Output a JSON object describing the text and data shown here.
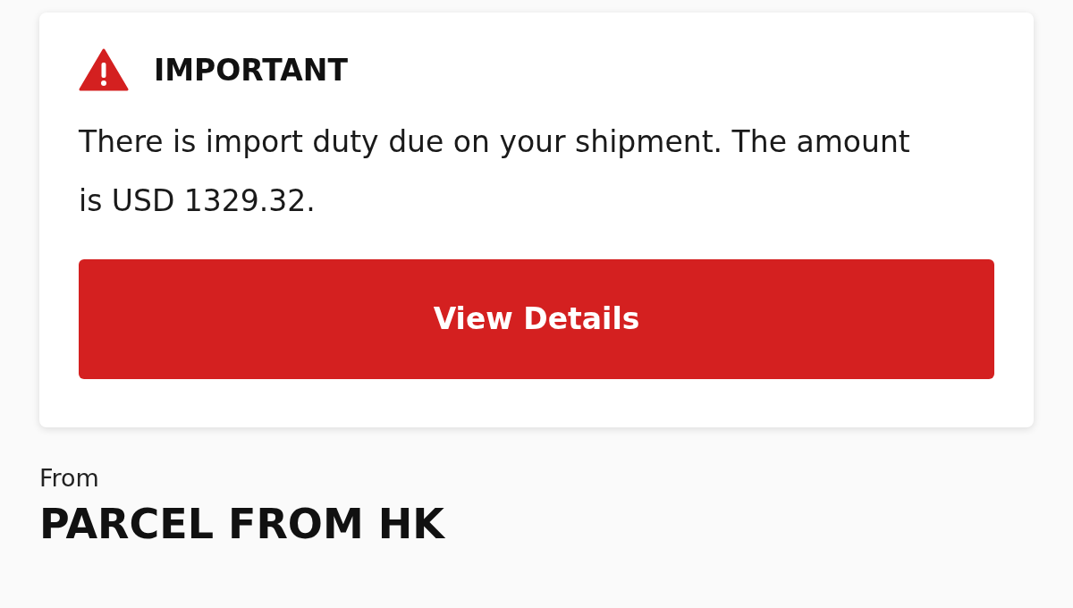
{
  "notice": {
    "title": "IMPORTANT",
    "message": "There is import duty due on your shipment. The amount is USD 1329.32.",
    "button": "View Details"
  },
  "sender": {
    "label": "From",
    "name": "PARCEL FROM HK"
  }
}
